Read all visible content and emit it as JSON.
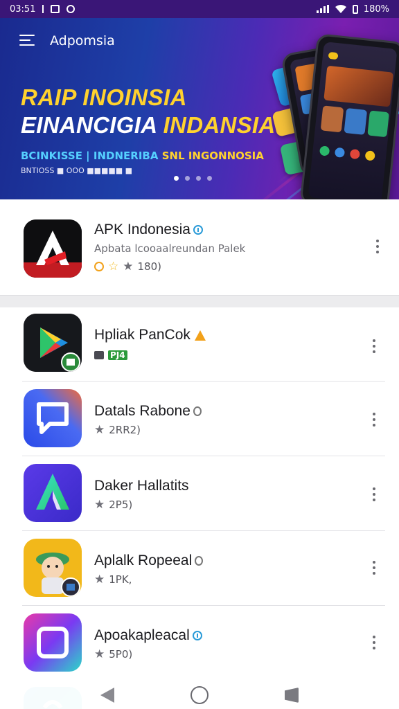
{
  "status_bar": {
    "time": "03:51",
    "battery": "180%",
    "icons": [
      "square-icon",
      "sync-icon",
      "signal-icon",
      "wifi-icon",
      "battery-icon"
    ]
  },
  "banner": {
    "app_title": "Adpomsia",
    "headline_1": "RAIP INOINSIA",
    "headline_2_white": "EINANCIGIA ",
    "headline_2_yellow": "INDANSIA",
    "tagline_a": "BCINKISSE | INDNERIBA",
    "tagline_b": "SNL INGONNOSIA",
    "subtag": "BNTIOSS ■ OOO ■■■■■ ■",
    "carousel_pages": 4,
    "active_page": 1
  },
  "featured": {
    "name": "APK Indonesia",
    "subtitle": "Apbata lcooaalreundan Palek",
    "rating_text": "180)"
  },
  "apps": [
    {
      "name": "Hpliak PanCok",
      "meta": "PJ4",
      "badge": "warning"
    },
    {
      "name": "Datals Rabone",
      "meta": "2RR2)",
      "badge": "gray"
    },
    {
      "name": "Daker Hallatits",
      "meta": "2P5)",
      "badge": "none"
    },
    {
      "name": "Aplalk Ropeeal",
      "meta": "1PK,",
      "badge": "gray"
    },
    {
      "name": "Apoakapleacal",
      "meta": "5P0)",
      "badge": "verified"
    }
  ],
  "colors": {
    "status_bar": "#3a1677",
    "banner_blue": "#1e3fa8",
    "banner_purple": "#7a1fb0",
    "headline_yellow": "#ffd22e",
    "verified_blue": "#2a9bd8",
    "warning_orange": "#f2a11a"
  }
}
